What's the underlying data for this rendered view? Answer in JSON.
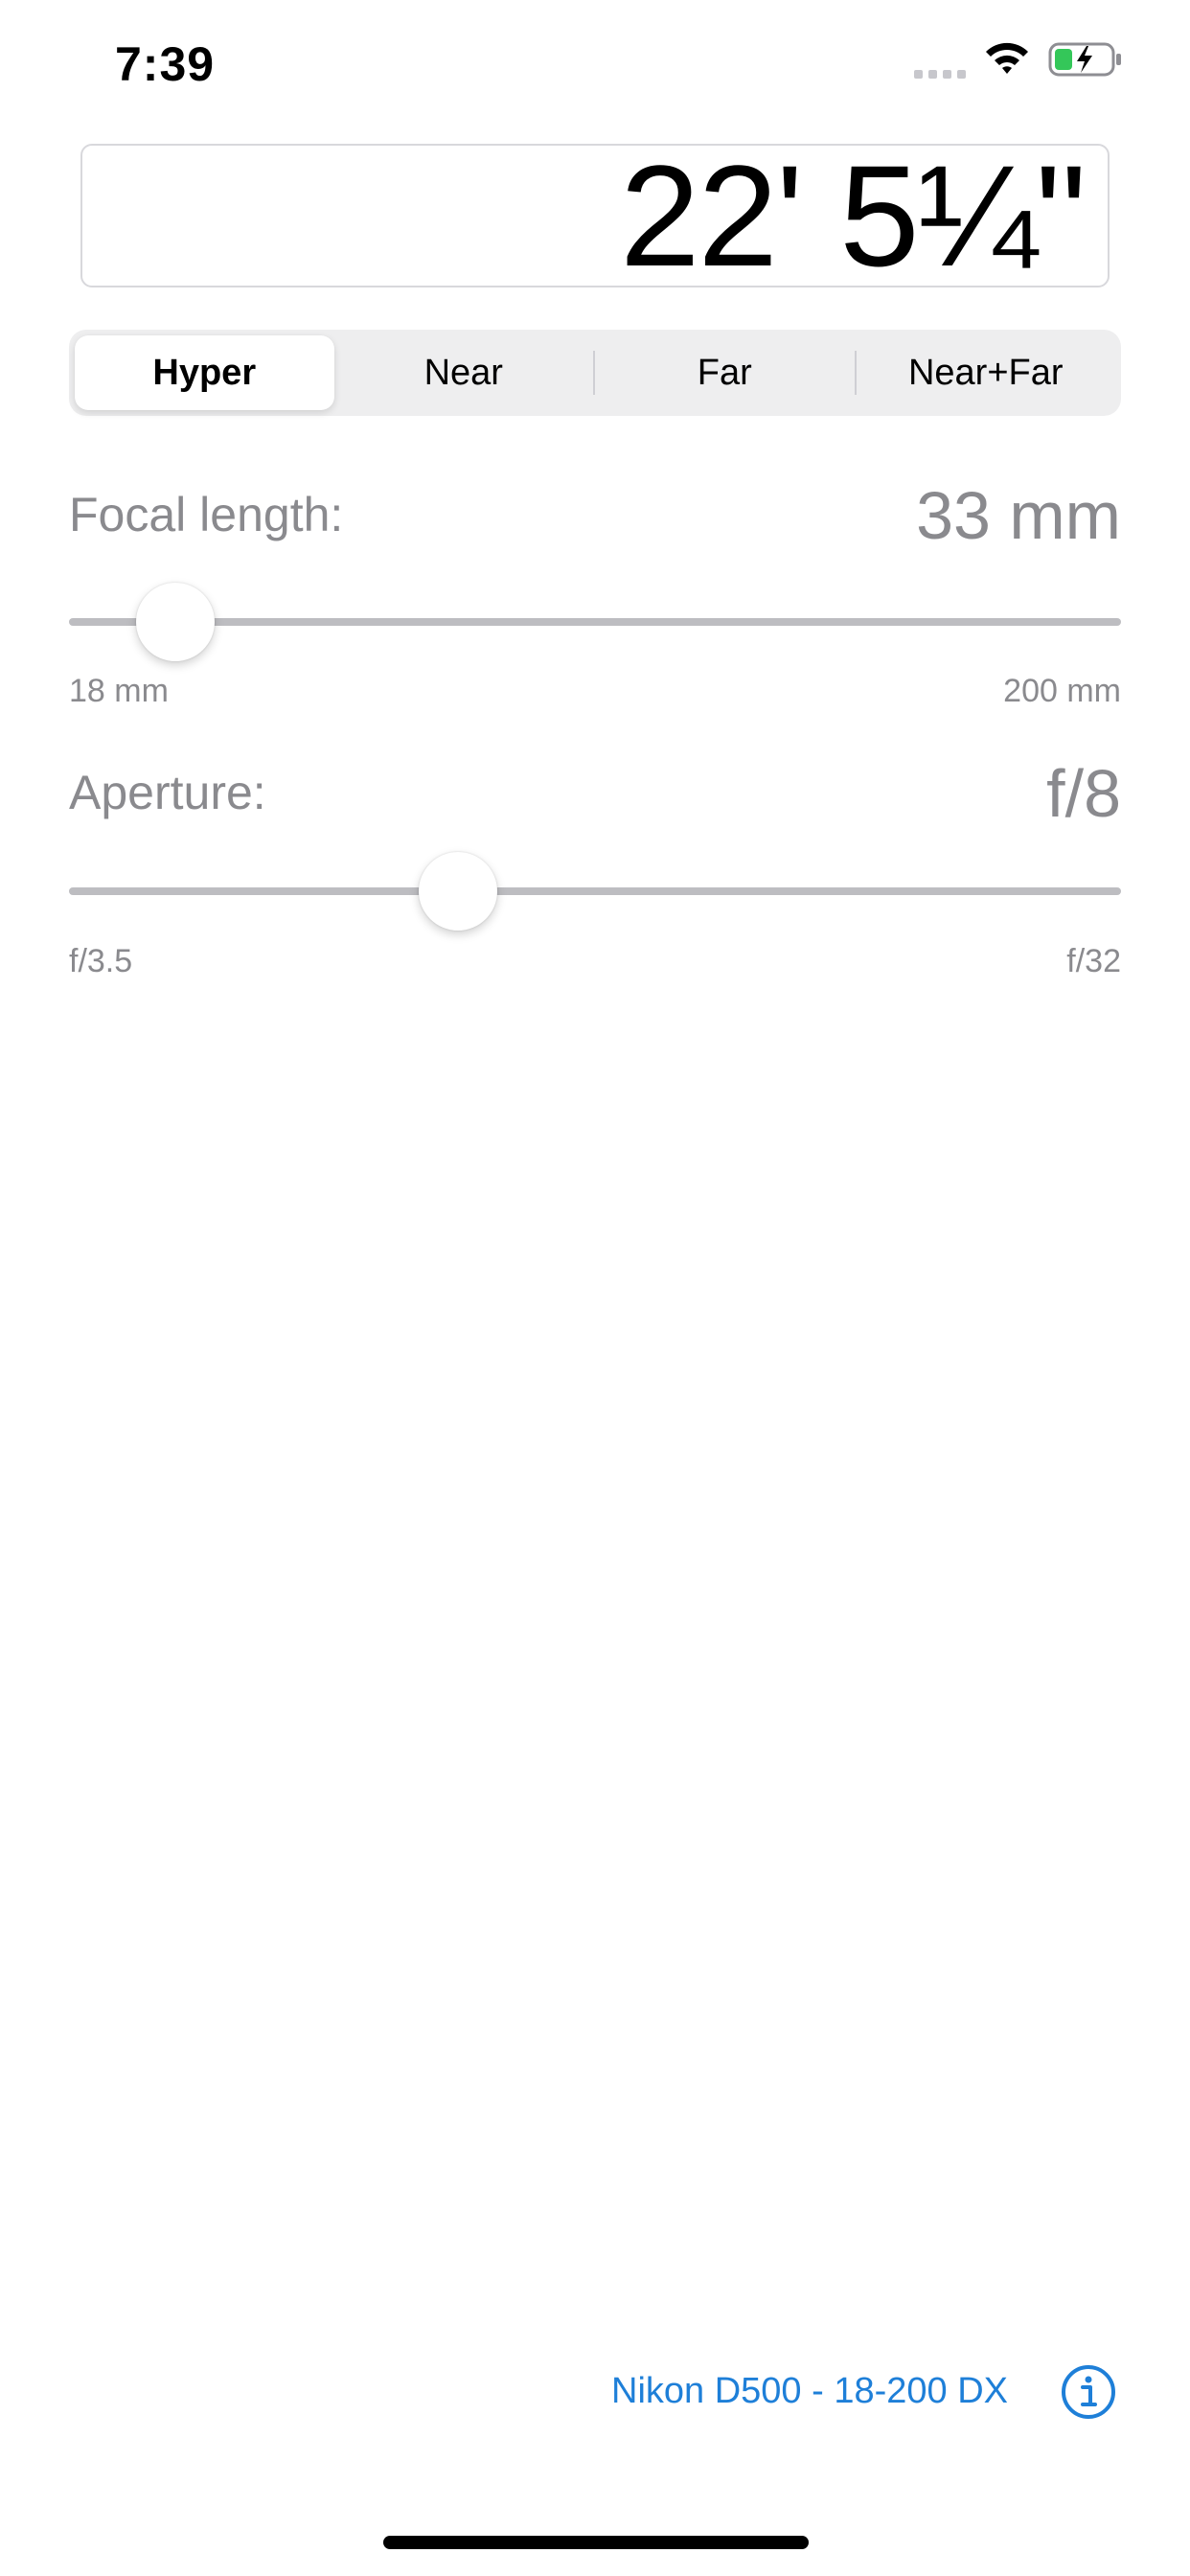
{
  "status_bar": {
    "time": "7:39",
    "icons": [
      "signal-icon",
      "wifi-icon",
      "battery-charging-icon"
    ]
  },
  "result": {
    "value": "22' 5¼\""
  },
  "mode_tabs": {
    "items": [
      {
        "label": "Hyper",
        "selected": true
      },
      {
        "label": "Near",
        "selected": false
      },
      {
        "label": "Far",
        "selected": false
      },
      {
        "label": "Near+Far",
        "selected": false
      }
    ]
  },
  "focal_length": {
    "label": "Focal length:",
    "value": "33 mm",
    "min_label": "18 mm",
    "max_label": "200 mm",
    "min": 18,
    "max": 200,
    "current": 33
  },
  "aperture": {
    "label": "Aperture:",
    "value": "f/8",
    "min_label": "f/3.5",
    "max_label": "f/32",
    "slider_fraction": 0.37
  },
  "footer": {
    "camera_label": "Nikon D500 - 18-200 DX",
    "info_icon": "info-icon"
  },
  "colors": {
    "accent": "#1e7fd8",
    "secondary_text": "#8a8a8e",
    "battery_green": "#34c759"
  }
}
